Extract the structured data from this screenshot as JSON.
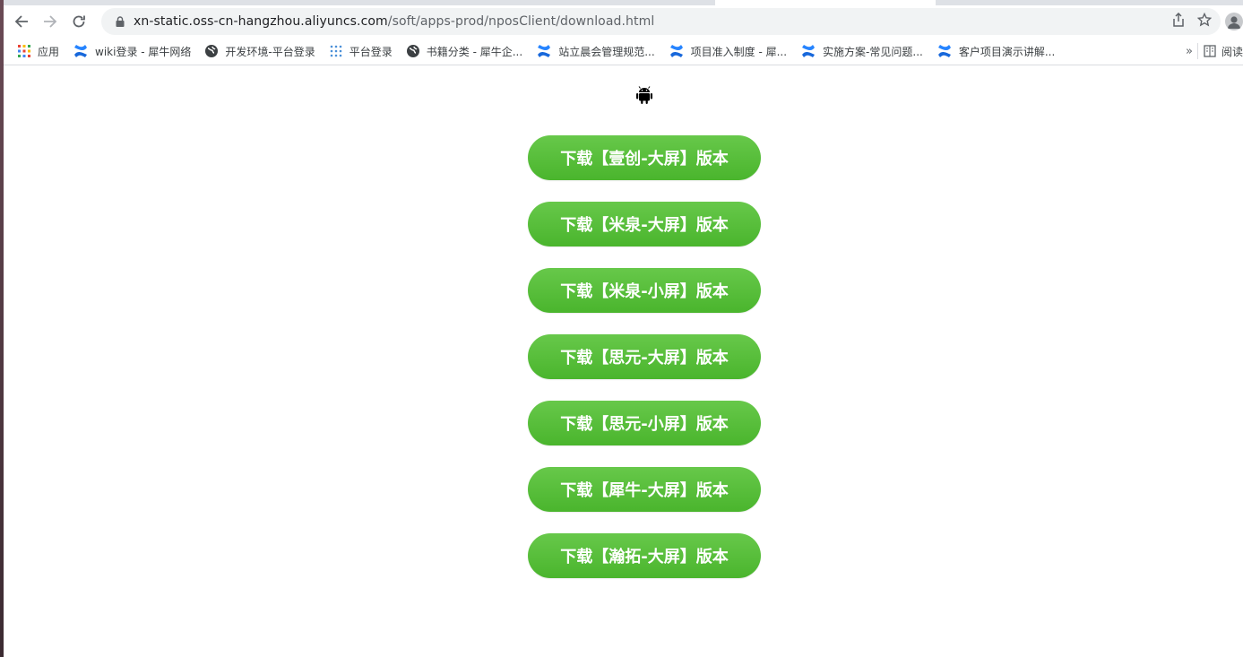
{
  "browser": {
    "url_host": "xn-static.oss-cn-hangzhou.aliyuncs.com",
    "url_path": "/soft/apps-prod/nposClient/download.html",
    "back_icon": "arrow-left-icon",
    "forward_icon": "arrow-right-icon",
    "reload_icon": "reload-icon"
  },
  "bookmarks": {
    "items": [
      {
        "label": "应用",
        "icon": "apps-grid-icon"
      },
      {
        "label": "wiki登录 - 犀牛网络",
        "icon": "confluence-icon"
      },
      {
        "label": "开发环境-平台登录",
        "icon": "globe-icon"
      },
      {
        "label": "平台登录",
        "icon": "dots-grid-icon"
      },
      {
        "label": "书籍分类 - 犀牛企...",
        "icon": "globe-icon"
      },
      {
        "label": "站立晨会管理规范...",
        "icon": "confluence-icon"
      },
      {
        "label": "项目准入制度 - 犀...",
        "icon": "confluence-icon"
      },
      {
        "label": "实施方案-常见问题...",
        "icon": "confluence-icon"
      },
      {
        "label": "客户项目演示讲解...",
        "icon": "confluence-icon"
      }
    ],
    "more": "»",
    "reading_list": "阅读"
  },
  "page": {
    "android_icon": "android-icon",
    "buttons": [
      {
        "label": "下载【壹创-大屏】版本"
      },
      {
        "label": "下载【米泉-大屏】版本"
      },
      {
        "label": "下载【米泉-小屏】版本"
      },
      {
        "label": "下载【思元-大屏】版本"
      },
      {
        "label": "下载【思元-小屏】版本"
      },
      {
        "label": "下载【犀牛-大屏】版本"
      },
      {
        "label": "下载【瀚拓-大屏】版本"
      }
    ],
    "button_color": "#52ba35"
  }
}
